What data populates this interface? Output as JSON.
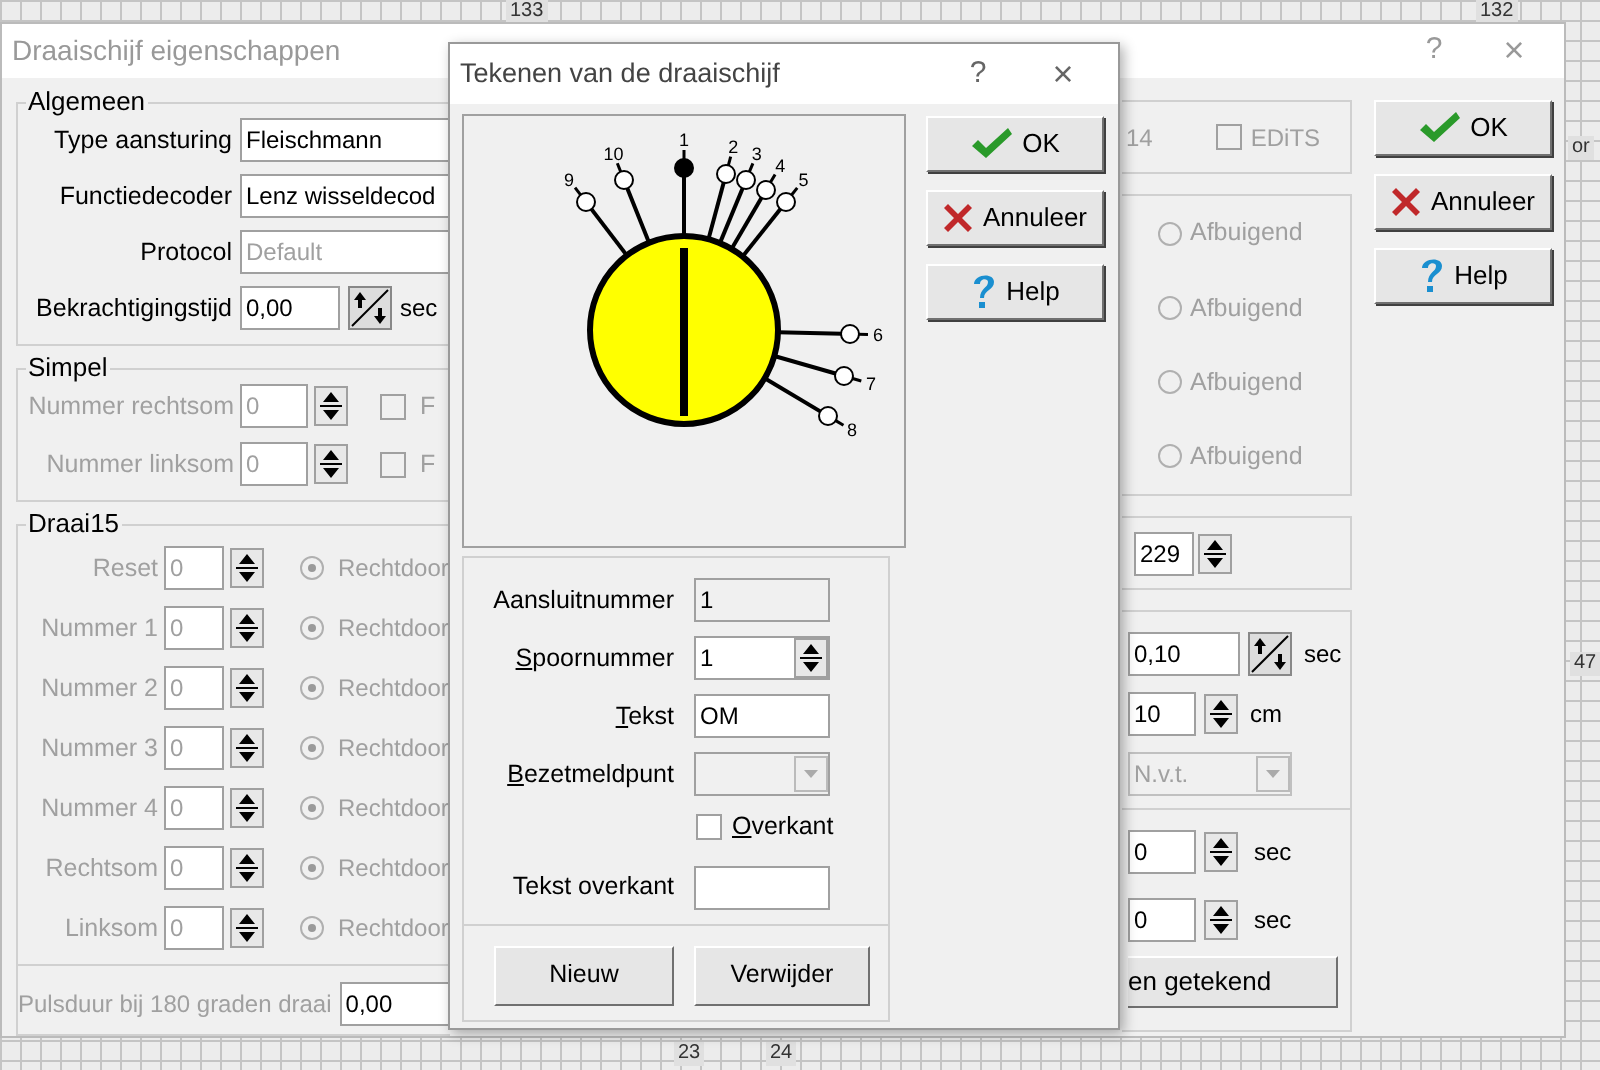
{
  "canvas": {
    "labels": [
      {
        "text": "133"
      },
      {
        "text": "132"
      },
      {
        "text": "or"
      },
      {
        "text": "47"
      },
      {
        "text": "23"
      },
      {
        "text": "24"
      }
    ]
  },
  "main_dialog": {
    "title": "Draaischijf eigenschappen",
    "help": "?",
    "close": "×",
    "algemeen": {
      "legend": "Algemeen",
      "rows": [
        {
          "label": "Type aansturing",
          "value": "Fleischmann",
          "kind": "combo",
          "disabled": false
        },
        {
          "label": "Functiedecoder",
          "value": "Lenz wisseldecod",
          "kind": "combo",
          "disabled": false
        },
        {
          "label": "Protocol",
          "value": "Default",
          "kind": "combo",
          "disabled": true
        },
        {
          "label": "Bekrachtigingstijd",
          "value": "0,00",
          "kind": "time",
          "unit": "sec",
          "disabled": false
        }
      ]
    },
    "simpel": {
      "legend": "Simpel",
      "rows": [
        {
          "label": "Nummer rechtsom",
          "value": "0",
          "option": "F",
          "checked": false
        },
        {
          "label": "Nummer linksom",
          "value": "0",
          "option": "F",
          "checked": false
        }
      ]
    },
    "draai": {
      "legend": "Draai15",
      "rows": [
        {
          "label": "Reset",
          "value": "0",
          "option": "Rechtdoor",
          "selected": true
        },
        {
          "label": "Nummer 1",
          "value": "0",
          "option": "Rechtdoor",
          "selected": true
        },
        {
          "label": "Nummer 2",
          "value": "0",
          "option": "Rechtdoor",
          "selected": true
        },
        {
          "label": "Nummer 3",
          "value": "0",
          "option": "Rechtdoor",
          "selected": true
        },
        {
          "label": "Nummer 4",
          "value": "0",
          "option": "Rechtdoor",
          "selected": true
        },
        {
          "label": "Rechtsom",
          "value": "0",
          "option": "Rechtdoor",
          "selected": true
        },
        {
          "label": "Linksom",
          "value": "0",
          "option": "Rechtdoor",
          "selected": true
        }
      ]
    },
    "pulsduur": {
      "label": "Pulsduur bij 180 graden draai",
      "value": "0,00"
    },
    "steps": "14",
    "edits": {
      "label": "EDiTS",
      "checked": false
    },
    "afbuigend": [
      {
        "label": "Afbuigend",
        "selected": false
      },
      {
        "label": "Afbuigend",
        "selected": false
      },
      {
        "label": "Afbuigend",
        "selected": false
      },
      {
        "label": "Afbuigend",
        "selected": false
      }
    ],
    "address": "229",
    "timing": [
      {
        "value": "0,10",
        "unit": "sec",
        "kind": "time"
      },
      {
        "value": "10",
        "unit": "cm",
        "kind": "spin"
      },
      {
        "value": "N.v.t.",
        "kind": "combo"
      }
    ],
    "delays": [
      {
        "value": "0",
        "unit": "sec"
      },
      {
        "value": "0",
        "unit": "sec"
      }
    ],
    "draw_button": "en getekend",
    "buttons": [
      {
        "label": "OK",
        "kind": "ok"
      },
      {
        "label": "Annuleer",
        "kind": "cancel"
      },
      {
        "label": "Help",
        "kind": "help"
      }
    ]
  },
  "draw_dialog": {
    "title": "Tekenen van de draaischijf",
    "help": "?",
    "close": "×",
    "tracks": [
      {
        "label": "1",
        "selected": true
      },
      {
        "label": "2",
        "selected": false
      },
      {
        "label": "3",
        "selected": false
      },
      {
        "label": "4",
        "selected": false
      },
      {
        "label": "5",
        "selected": false
      },
      {
        "label": "6",
        "selected": false
      },
      {
        "label": "7",
        "selected": false
      },
      {
        "label": "8",
        "selected": false
      },
      {
        "label": "9",
        "selected": false
      },
      {
        "label": "10",
        "selected": false
      }
    ],
    "fields": [
      {
        "label": "Aansluitnummer",
        "mnemonic": false,
        "value": "1",
        "kind": "readonly"
      },
      {
        "label": "Spoornummer",
        "mnemonic": true,
        "value": "1",
        "kind": "spin"
      },
      {
        "label": "Tekst",
        "mnemonic": true,
        "value": "OM",
        "kind": "text"
      },
      {
        "label": "Bezetmeldpunt",
        "mnemonic": true,
        "kind": "combo"
      }
    ],
    "overkant": {
      "label": "Overkant",
      "mnemonic": true,
      "checked": false
    },
    "overkant_text": {
      "label": "Tekst overkant"
    },
    "bottom_buttons": [
      "Nieuw",
      "Verwijder"
    ],
    "buttons": [
      {
        "label": "OK",
        "kind": "ok"
      },
      {
        "label": "Annuleer",
        "kind": "cancel"
      },
      {
        "label": "Help",
        "kind": "help"
      }
    ]
  }
}
